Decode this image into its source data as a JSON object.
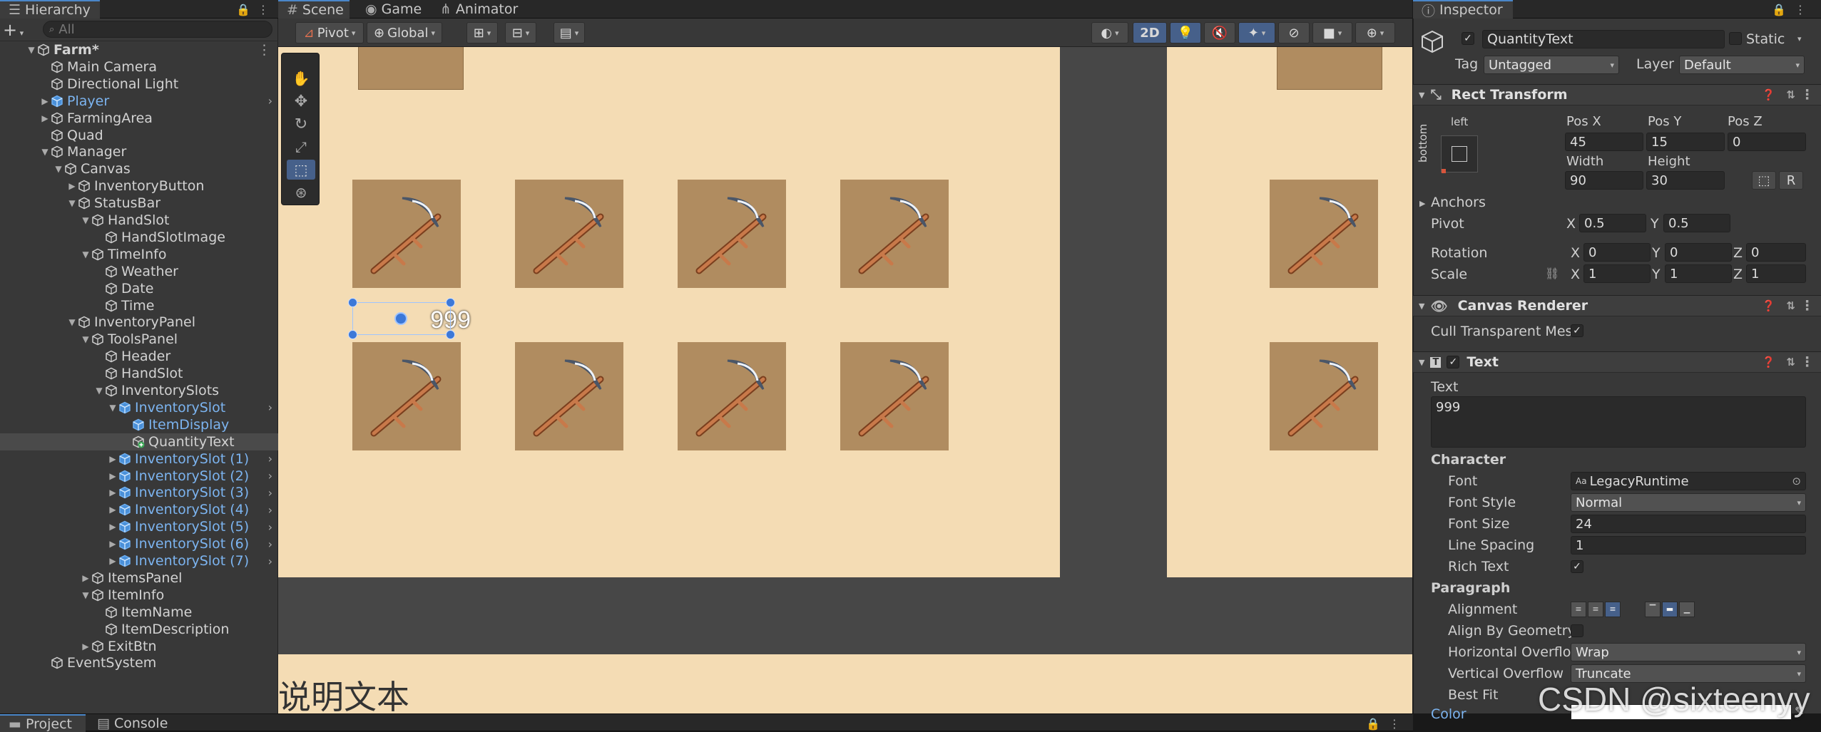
{
  "hierarchy": {
    "tab_label": "Hierarchy",
    "search_placeholder": "All",
    "rows": [
      {
        "label": "Farm*",
        "depth": 0,
        "arrow": "down",
        "type": "scene"
      },
      {
        "label": "Main Camera",
        "depth": 1,
        "arrow": "none",
        "type": "go"
      },
      {
        "label": "Directional Light",
        "depth": 1,
        "arrow": "none",
        "type": "go"
      },
      {
        "label": "Player",
        "depth": 1,
        "arrow": "right",
        "type": "prefab",
        "more": true
      },
      {
        "label": "FarmingArea",
        "depth": 1,
        "arrow": "right",
        "type": "go"
      },
      {
        "label": "Quad",
        "depth": 1,
        "arrow": "none",
        "type": "go"
      },
      {
        "label": "Manager",
        "depth": 1,
        "arrow": "down",
        "type": "go"
      },
      {
        "label": "Canvas",
        "depth": 2,
        "arrow": "down",
        "type": "go"
      },
      {
        "label": "InventoryButton",
        "depth": 3,
        "arrow": "right",
        "type": "go"
      },
      {
        "label": "StatusBar",
        "depth": 3,
        "arrow": "down",
        "type": "go"
      },
      {
        "label": "HandSlot",
        "depth": 4,
        "arrow": "down",
        "type": "go"
      },
      {
        "label": "HandSlotImage",
        "depth": 5,
        "arrow": "none",
        "type": "go"
      },
      {
        "label": "TimeInfo",
        "depth": 4,
        "arrow": "down",
        "type": "go"
      },
      {
        "label": "Weather",
        "depth": 5,
        "arrow": "none",
        "type": "go"
      },
      {
        "label": "Date",
        "depth": 5,
        "arrow": "none",
        "type": "go"
      },
      {
        "label": "Time",
        "depth": 5,
        "arrow": "none",
        "type": "go"
      },
      {
        "label": "InventoryPanel",
        "depth": 3,
        "arrow": "down",
        "type": "go"
      },
      {
        "label": "ToolsPanel",
        "depth": 4,
        "arrow": "down",
        "type": "go"
      },
      {
        "label": "Header",
        "depth": 5,
        "arrow": "none",
        "type": "go"
      },
      {
        "label": "HandSlot",
        "depth": 5,
        "arrow": "none",
        "type": "go"
      },
      {
        "label": "InventorySlots",
        "depth": 5,
        "arrow": "down",
        "type": "go"
      },
      {
        "label": "InventorySlot",
        "depth": 6,
        "arrow": "down",
        "type": "prefab",
        "more": true
      },
      {
        "label": "ItemDisplay",
        "depth": 7,
        "arrow": "none",
        "type": "prefab"
      },
      {
        "label": "QuantityText",
        "depth": 7,
        "arrow": "none",
        "type": "added",
        "selected": true
      },
      {
        "label": "InventorySlot (1)",
        "depth": 6,
        "arrow": "right",
        "type": "prefab",
        "more": true
      },
      {
        "label": "InventorySlot (2)",
        "depth": 6,
        "arrow": "right",
        "type": "prefab",
        "more": true
      },
      {
        "label": "InventorySlot (3)",
        "depth": 6,
        "arrow": "right",
        "type": "prefab",
        "more": true
      },
      {
        "label": "InventorySlot (4)",
        "depth": 6,
        "arrow": "right",
        "type": "prefab",
        "more": true
      },
      {
        "label": "InventorySlot (5)",
        "depth": 6,
        "arrow": "right",
        "type": "prefab",
        "more": true
      },
      {
        "label": "InventorySlot (6)",
        "depth": 6,
        "arrow": "right",
        "type": "prefab",
        "more": true
      },
      {
        "label": "InventorySlot (7)",
        "depth": 6,
        "arrow": "right",
        "type": "prefab",
        "more": true
      },
      {
        "label": "ItemsPanel",
        "depth": 4,
        "arrow": "right",
        "type": "go"
      },
      {
        "label": "ItemInfo",
        "depth": 4,
        "arrow": "down",
        "type": "go"
      },
      {
        "label": "ItemName",
        "depth": 5,
        "arrow": "none",
        "type": "go"
      },
      {
        "label": "ItemDescription",
        "depth": 5,
        "arrow": "none",
        "type": "go"
      },
      {
        "label": "ExitBtn",
        "depth": 4,
        "arrow": "right",
        "type": "go"
      },
      {
        "label": "EventSystem",
        "depth": 1,
        "arrow": "none",
        "type": "go"
      }
    ]
  },
  "scene": {
    "tabs": [
      "Scene",
      "Game",
      "Animator"
    ],
    "pivot_label": "Pivot",
    "global_label": "Global",
    "mode_2d": "2D",
    "quantity_text": "999",
    "description_text": "说明文本"
  },
  "inspector": {
    "tab_label": "Inspector",
    "object_name": "QuantityText",
    "static_label": "Static",
    "tag_label": "Tag",
    "tag_value": "Untagged",
    "layer_label": "Layer",
    "layer_value": "Default",
    "rect_transform": {
      "title": "Rect Transform",
      "anchor_h": "left",
      "anchor_v": "bottom",
      "posx_label": "Pos X",
      "posx": "45",
      "posy_label": "Pos Y",
      "posy": "15",
      "posz_label": "Pos Z",
      "posz": "0",
      "width_label": "Width",
      "width": "90",
      "height_label": "Height",
      "height": "30",
      "anchors_label": "Anchors",
      "pivot_label": "Pivot",
      "pivot_x": "0.5",
      "pivot_y": "0.5",
      "rotation_label": "Rotation",
      "rot_x": "0",
      "rot_y": "0",
      "rot_z": "0",
      "scale_label": "Scale",
      "scale_x": "1",
      "scale_y": "1",
      "scale_z": "1",
      "axis_x": "X",
      "axis_y": "Y",
      "axis_z": "Z",
      "raw_button": "R"
    },
    "canvas_renderer": {
      "title": "Canvas Renderer",
      "cull_label": "Cull Transparent Mes"
    },
    "text": {
      "title": "Text",
      "text_label": "Text",
      "text_value": "999",
      "character_label": "Character",
      "font_label": "Font",
      "font_value": "LegacyRuntime",
      "font_style_label": "Font Style",
      "font_style_value": "Normal",
      "font_size_label": "Font Size",
      "font_size_value": "24",
      "line_spacing_label": "Line Spacing",
      "line_spacing_value": "1",
      "rich_text_label": "Rich Text",
      "paragraph_label": "Paragraph",
      "alignment_label": "Alignment",
      "align_geometry_label": "Align By Geometry",
      "h_overflow_label": "Horizontal Overflov",
      "h_overflow_value": "Wrap",
      "v_overflow_label": "Vertical Overflow",
      "v_overflow_value": "Truncate",
      "best_fit_label": "Best Fit",
      "color_label": "Color"
    }
  },
  "bottom": {
    "project_tab": "Project",
    "console_tab": "Console"
  },
  "watermark": "CSDN @sixteenyy",
  "colors": {
    "accent": "#4a86c8",
    "prefab_text": "#7cb4f0",
    "scene_bg": "#f4dcb4",
    "slot_bg": "#b08c60"
  }
}
